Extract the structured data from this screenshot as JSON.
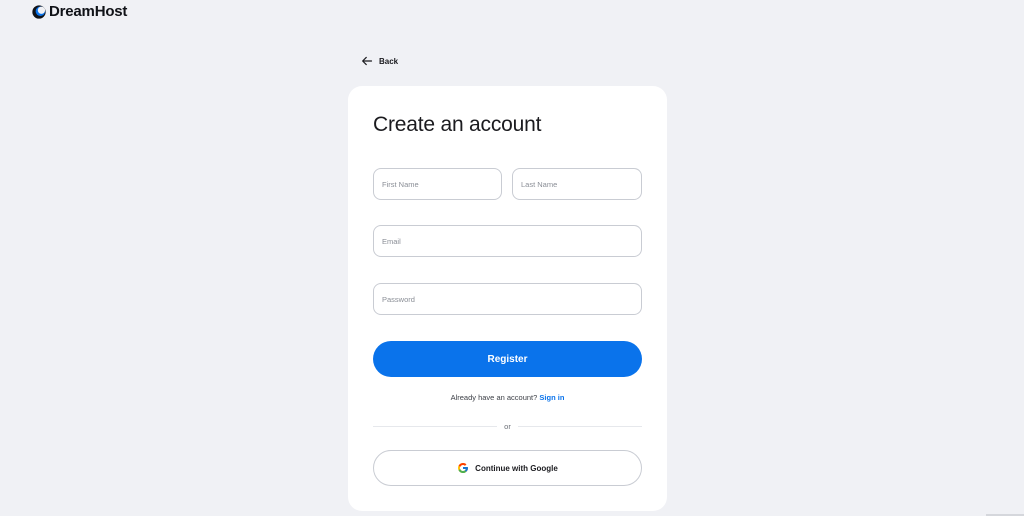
{
  "brand": {
    "name": "DreamHost",
    "icon": "dreamhost-moon-logo",
    "accent_color": "#0a73eb"
  },
  "nav": {
    "back_label": "Back",
    "back_icon": "arrow-left-icon"
  },
  "form": {
    "title": "Create an account",
    "first_name": {
      "value": "",
      "placeholder": "First Name"
    },
    "last_name": {
      "value": "",
      "placeholder": "Last Name"
    },
    "email": {
      "value": "",
      "placeholder": "Email"
    },
    "password": {
      "value": "",
      "placeholder": "Password"
    },
    "register_label": "Register",
    "signin_prompt": "Already have an account?",
    "signin_link": "Sign in",
    "divider_text": "or",
    "google_label": "Continue with Google",
    "google_icon": "google-g-icon"
  },
  "colors": {
    "background": "#f0f1f5",
    "card": "#ffffff",
    "primary_button": "#0a73eb",
    "field_border": "#c9ccd3"
  }
}
